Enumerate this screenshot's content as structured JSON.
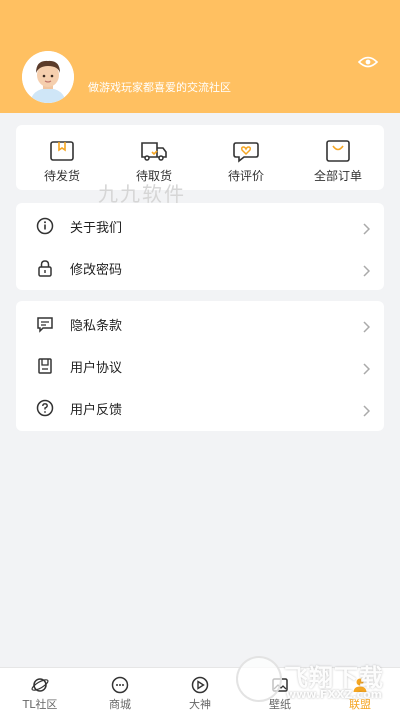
{
  "theme": {
    "accent": "#ffc061",
    "active_tab": "#f5a623",
    "background": "#f2f3f5"
  },
  "header": {
    "slogan": "做游戏玩家都喜爱的交流社区",
    "avatar_icon": "avatar",
    "eye_icon": "eye-icon"
  },
  "orders": [
    {
      "label": "待发货",
      "icon": "box-icon"
    },
    {
      "label": "待取货",
      "icon": "truck-icon"
    },
    {
      "label": "待评价",
      "icon": "heart-chat-icon"
    },
    {
      "label": "全部订单",
      "icon": "bag-icon"
    }
  ],
  "watermark": {
    "text": "九九软件"
  },
  "menu_group_1": [
    {
      "label": "关于我们",
      "icon": "info-icon"
    },
    {
      "label": "修改密码",
      "icon": "lock-icon"
    }
  ],
  "menu_group_2": [
    {
      "label": "隐私条款",
      "icon": "message-icon"
    },
    {
      "label": "用户协议",
      "icon": "document-icon"
    },
    {
      "label": "用户反馈",
      "icon": "help-icon"
    }
  ],
  "tabbar": [
    {
      "label": "TL社区",
      "icon": "planet-icon",
      "active": false
    },
    {
      "label": "商城",
      "icon": "chat-bubble-icon",
      "active": false
    },
    {
      "label": "大神",
      "icon": "play-icon",
      "active": false
    },
    {
      "label": "壁纸",
      "icon": "image-icon",
      "active": false
    },
    {
      "label": "联盟",
      "icon": "user-icon",
      "active": true
    }
  ],
  "logo_watermark": {
    "brand": "飞翔下载",
    "url": "www.FXXZ.com"
  }
}
